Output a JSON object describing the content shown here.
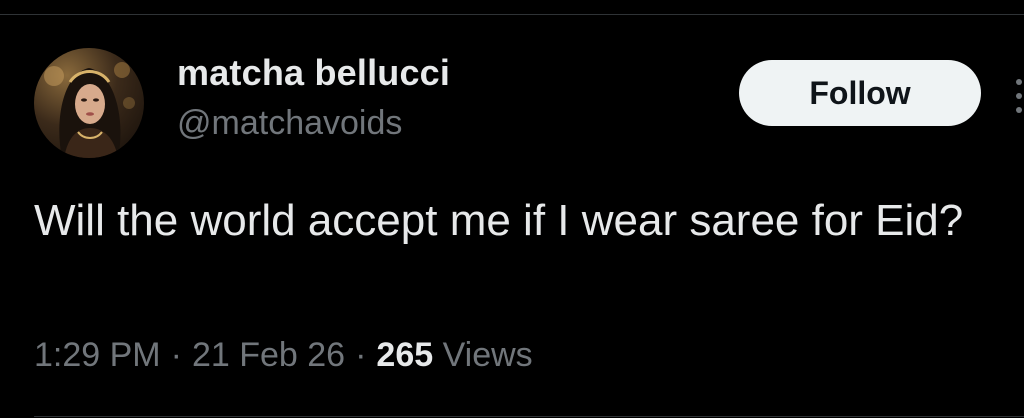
{
  "tweet": {
    "author": {
      "display_name": "matcha bellucci",
      "handle": "@matchavoids",
      "avatar_icon": "profile-photo"
    },
    "follow_label": "Follow",
    "more_icon": "vertical-ellipsis-icon",
    "text": "Will the world accept me if I wear saree for Eid?",
    "time": "1:29 PM",
    "date": "21 Feb 26",
    "separator": "·",
    "views_count": "265",
    "views_label": "Views"
  },
  "colors": {
    "background": "#000000",
    "primary_text": "#e7e9ea",
    "secondary_text": "#71767b",
    "follow_button_bg": "#eff3f4",
    "follow_button_text": "#0f1419",
    "divider": "#2f3336"
  }
}
